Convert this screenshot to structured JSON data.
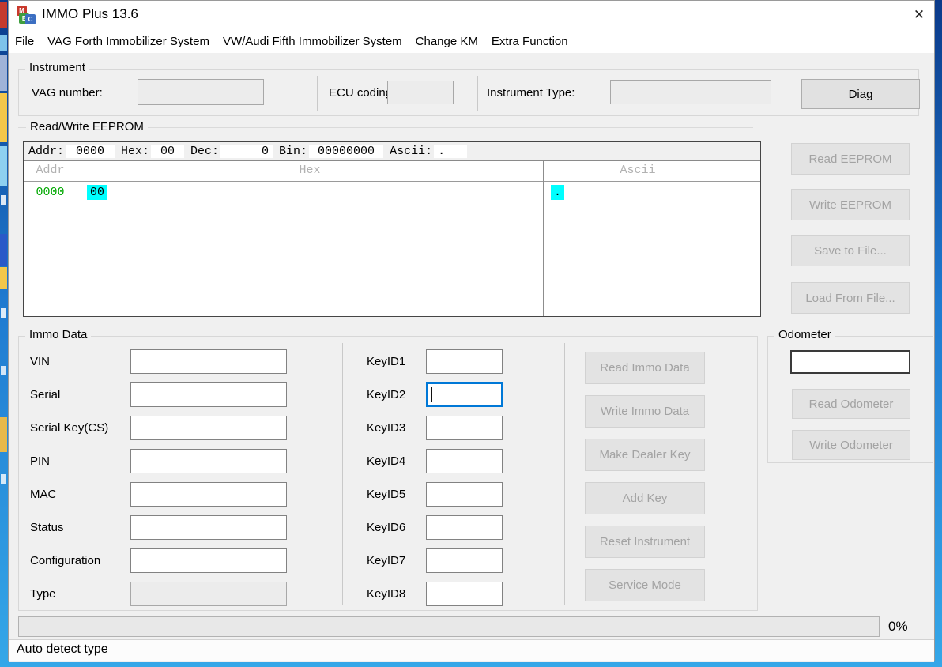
{
  "titlebar": {
    "title": "IMMO Plus 13.6",
    "close_glyph": "✕",
    "icon_letters": [
      "M",
      "E",
      "C"
    ]
  },
  "menu": {
    "items": [
      "File",
      "VAG Forth Immobilizer System",
      "VW/Audi Fifth Immobilizer System",
      "Change KM",
      "Extra Function"
    ]
  },
  "instrument": {
    "group_label": "Instrument",
    "vag_label": "VAG number:",
    "vag_value": "",
    "ecu_label": "ECU coding:",
    "ecu_value": "",
    "type_label": "Instrument Type:",
    "type_value": "",
    "diag_button": "Diag"
  },
  "eeprom": {
    "group_label": "Read/Write EEPROM",
    "inspector": {
      "addr_label": "Addr:",
      "addr": "0000",
      "hex_label": "Hex:",
      "hex": "00",
      "dec_label": "Dec:",
      "dec": "0",
      "bin_label": "Bin:",
      "bin": "00000000",
      "ascii_label": "Ascii:",
      "ascii": "."
    },
    "columns": [
      "Addr",
      "Hex",
      "Ascii"
    ],
    "rows": [
      {
        "addr": "0000",
        "hex": "00",
        "ascii": "."
      }
    ],
    "buttons": [
      "Read EEPROM",
      "Write EEPROM",
      "Save to File...",
      "Load From File..."
    ]
  },
  "immo": {
    "group_label": "Immo Data",
    "fields": [
      {
        "label": "VIN",
        "value": ""
      },
      {
        "label": "Serial",
        "value": ""
      },
      {
        "label": "Serial Key(CS)",
        "value": ""
      },
      {
        "label": "PIN",
        "value": ""
      },
      {
        "label": "MAC",
        "value": ""
      },
      {
        "label": "Status",
        "value": ""
      },
      {
        "label": "Configuration",
        "value": ""
      },
      {
        "label": "Type",
        "value": ""
      }
    ],
    "keys": [
      {
        "label": "KeyID1",
        "value": ""
      },
      {
        "label": "KeyID2",
        "value": ""
      },
      {
        "label": "KeyID3",
        "value": ""
      },
      {
        "label": "KeyID4",
        "value": ""
      },
      {
        "label": "KeyID5",
        "value": ""
      },
      {
        "label": "KeyID6",
        "value": ""
      },
      {
        "label": "KeyID7",
        "value": ""
      },
      {
        "label": "KeyID8",
        "value": ""
      }
    ],
    "buttons": [
      "Read Immo Data",
      "Write Immo Data",
      "Make Dealer Key",
      "Add Key",
      "Reset Instrument",
      "Service Mode"
    ]
  },
  "odometer": {
    "group_label": "Odometer",
    "value": "",
    "buttons": [
      "Read Odometer",
      "Write Odometer"
    ]
  },
  "progress": {
    "percent": 0,
    "percent_label": "0%"
  },
  "statusbar": {
    "text": "Auto detect type"
  },
  "colors": {
    "selection_cyan": "#00ffff",
    "addr_green": "#00a800",
    "focus_blue": "#0078d7",
    "desktop_blue": "#1f7ad0"
  }
}
